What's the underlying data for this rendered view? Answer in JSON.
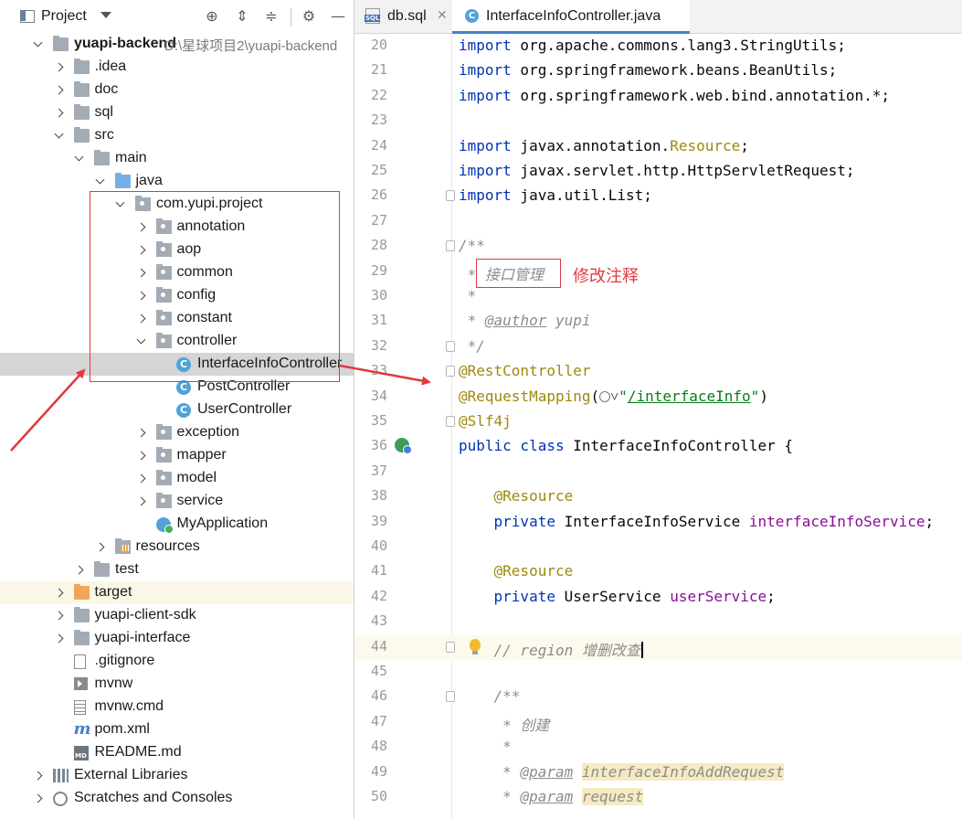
{
  "project_panel": {
    "title": "Project",
    "toolbar_icons": [
      "crosshair-icon",
      "expand-all-icon",
      "collapse-all-icon",
      "gear-icon",
      "minimize-icon"
    ],
    "root": {
      "name": "yuapi-backend",
      "path": "D:\\星球项目2\\yuapi-backend"
    },
    "tree": [
      {
        "label": "yuapi-backend",
        "level": 0,
        "state": "expanded",
        "icon": "module-folder-icon"
      },
      {
        "label": ".idea",
        "level": 1,
        "state": "collapsed",
        "icon": "folder-icon"
      },
      {
        "label": "doc",
        "level": 1,
        "state": "collapsed",
        "icon": "folder-icon"
      },
      {
        "label": "sql",
        "level": 1,
        "state": "collapsed",
        "icon": "folder-icon"
      },
      {
        "label": "src",
        "level": 1,
        "state": "expanded",
        "icon": "folder-icon"
      },
      {
        "label": "main",
        "level": 2,
        "state": "expanded",
        "icon": "folder-icon"
      },
      {
        "label": "java",
        "level": 3,
        "state": "expanded",
        "icon": "source-folder-icon"
      },
      {
        "label": "com.yupi.project",
        "level": 4,
        "state": "expanded",
        "icon": "package-icon"
      },
      {
        "label": "annotation",
        "level": 5,
        "state": "collapsed",
        "icon": "package-icon"
      },
      {
        "label": "aop",
        "level": 5,
        "state": "collapsed",
        "icon": "package-icon"
      },
      {
        "label": "common",
        "level": 5,
        "state": "collapsed",
        "icon": "package-icon"
      },
      {
        "label": "config",
        "level": 5,
        "state": "collapsed",
        "icon": "package-icon"
      },
      {
        "label": "constant",
        "level": 5,
        "state": "collapsed",
        "icon": "package-icon"
      },
      {
        "label": "controller",
        "level": 5,
        "state": "expanded",
        "icon": "package-icon"
      },
      {
        "label": "InterfaceInfoController",
        "level": 6,
        "state": "leaf",
        "icon": "java-class-icon",
        "selected": true
      },
      {
        "label": "PostController",
        "level": 6,
        "state": "leaf",
        "icon": "java-class-icon"
      },
      {
        "label": "UserController",
        "level": 6,
        "state": "leaf",
        "icon": "java-class-icon"
      },
      {
        "label": "exception",
        "level": 5,
        "state": "collapsed",
        "icon": "package-icon"
      },
      {
        "label": "mapper",
        "level": 5,
        "state": "collapsed",
        "icon": "package-icon"
      },
      {
        "label": "model",
        "level": 5,
        "state": "collapsed",
        "icon": "package-icon"
      },
      {
        "label": "service",
        "level": 5,
        "state": "collapsed",
        "icon": "package-icon"
      },
      {
        "label": "MyApplication",
        "level": 5,
        "state": "leaf",
        "icon": "spring-app-icon"
      },
      {
        "label": "resources",
        "level": 3,
        "state": "collapsed",
        "icon": "resources-folder-icon"
      },
      {
        "label": "test",
        "level": 2,
        "state": "collapsed",
        "icon": "folder-icon"
      },
      {
        "label": "target",
        "level": 1,
        "state": "collapsed",
        "icon": "excluded-folder-icon"
      },
      {
        "label": "yuapi-client-sdk",
        "level": 1,
        "state": "collapsed",
        "icon": "folder-icon"
      },
      {
        "label": "yuapi-interface",
        "level": 1,
        "state": "collapsed",
        "icon": "folder-icon"
      },
      {
        "label": ".gitignore",
        "level": 1,
        "state": "leaf",
        "icon": "file-icon"
      },
      {
        "label": "mvnw",
        "level": 1,
        "state": "leaf",
        "icon": "exec-file-icon"
      },
      {
        "label": "mvnw.cmd",
        "level": 1,
        "state": "leaf",
        "icon": "text-file-icon"
      },
      {
        "label": "pom.xml",
        "level": 1,
        "state": "leaf",
        "icon": "maven-icon"
      },
      {
        "label": "README.md",
        "level": 1,
        "state": "leaf",
        "icon": "markdown-icon"
      },
      {
        "label": "External Libraries",
        "level": 0,
        "state": "collapsed",
        "icon": "library-icon"
      },
      {
        "label": "Scratches and Consoles",
        "level": 0,
        "state": "collapsed",
        "icon": "scratch-icon"
      }
    ]
  },
  "editor": {
    "tabs": [
      {
        "label": "db.sql",
        "active": false,
        "icon": "sql-file-icon"
      },
      {
        "label": "InterfaceInfoController.java",
        "active": true,
        "icon": "java-class-icon"
      }
    ],
    "lines": [
      {
        "n": "20",
        "text": "import org.apache.commons.lang3.StringUtils;"
      },
      {
        "n": "21",
        "text": "import org.springframework.beans.BeanUtils;"
      },
      {
        "n": "22",
        "text": "import org.springframework.web.bind.annotation.*;"
      },
      {
        "n": "23",
        "text": ""
      },
      {
        "n": "24",
        "text": "import javax.annotation.Resource;"
      },
      {
        "n": "25",
        "text": "import javax.servlet.http.HttpServletRequest;"
      },
      {
        "n": "26",
        "text": "import java.util.List;"
      },
      {
        "n": "27",
        "text": ""
      },
      {
        "n": "28",
        "text": "/**"
      },
      {
        "n": "29",
        "text": " * 接口管理"
      },
      {
        "n": "30",
        "text": " *"
      },
      {
        "n": "31",
        "text": " * @author yupi"
      },
      {
        "n": "32",
        "text": " */"
      },
      {
        "n": "33",
        "text": "@RestController"
      },
      {
        "n": "34",
        "text": "@RequestMapping(\"/interfaceInfo\")"
      },
      {
        "n": "35",
        "text": "@Slf4j"
      },
      {
        "n": "36",
        "text": "public class InterfaceInfoController {"
      },
      {
        "n": "37",
        "text": ""
      },
      {
        "n": "38",
        "text": "    @Resource"
      },
      {
        "n": "39",
        "text": "    private InterfaceInfoService interfaceInfoService;"
      },
      {
        "n": "40",
        "text": ""
      },
      {
        "n": "41",
        "text": "    @Resource"
      },
      {
        "n": "42",
        "text": "    private UserService userService;"
      },
      {
        "n": "43",
        "text": ""
      },
      {
        "n": "44",
        "text": "    // region 增删改查"
      },
      {
        "n": "45",
        "text": ""
      },
      {
        "n": "46",
        "text": "    /**"
      },
      {
        "n": "47",
        "text": "     * 创建"
      },
      {
        "n": "48",
        "text": "     *"
      },
      {
        "n": "49",
        "text": "     * @param interfaceInfoAddRequest"
      },
      {
        "n": "50",
        "text": "     * @param request"
      }
    ],
    "current_line": "44"
  },
  "annotation": {
    "note": "修改注释",
    "color": "#e0393e"
  },
  "colors": {
    "keyword": "#0033b3",
    "annotation": "#9e880d",
    "comment": "#8c8c8c",
    "string": "#067d17",
    "field": "#871094",
    "selection": "#d5d5d5",
    "accent": "#4083c9"
  }
}
